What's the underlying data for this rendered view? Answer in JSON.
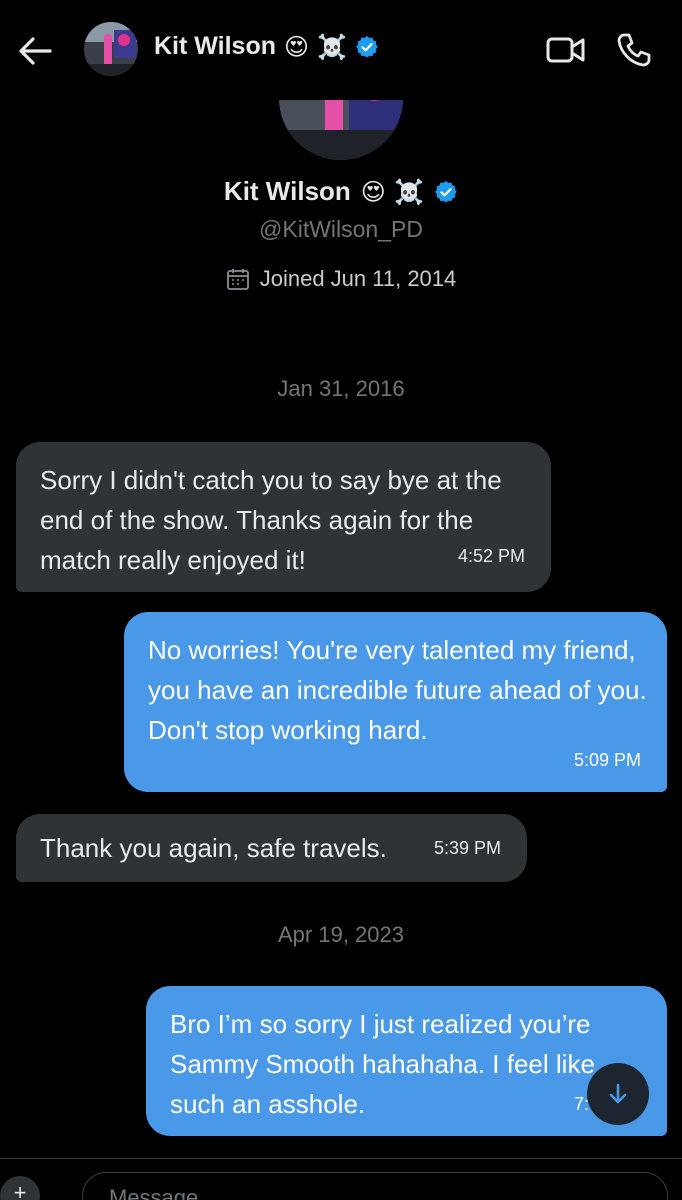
{
  "header": {
    "name": "Kit Wilson",
    "emoji": "😍 ☠️",
    "icons": {
      "back": "back-arrow-icon",
      "video": "video-camera-icon",
      "call": "phone-icon",
      "verified": "verified-badge-icon"
    }
  },
  "profile": {
    "name": "Kit Wilson",
    "emoji": "😍 ☠️",
    "handle": "@KitWilson_PD",
    "joined": "Joined Jun 11, 2014"
  },
  "conversation": {
    "date1": "Jan 31, 2016",
    "date2": "Apr 19, 2023",
    "messages": [
      {
        "side": "received",
        "text": "Sorry I didn't catch you to say bye at the end of the show. Thanks again for the match really enjoyed it!",
        "time": "4:52 PM"
      },
      {
        "side": "sent",
        "text": "No worries! You're very talented my friend, you have an incredible future ahead of you. Don't stop working hard.",
        "time": "5:09 PM"
      },
      {
        "side": "received",
        "text": "Thank you again, safe travels.",
        "time": "5:39 PM"
      },
      {
        "side": "sent",
        "text": "Bro I’m so sorry I just realized you’re Sammy Smooth hahahaha. I feel like such an asshole.",
        "time": "7:"
      }
    ]
  },
  "composer": {
    "placeholder": "Message",
    "add_label": "+"
  },
  "colors": {
    "sent_bubble": "#4a99e9",
    "received_bubble": "#2f3336",
    "verified": "#1d9bf0"
  }
}
